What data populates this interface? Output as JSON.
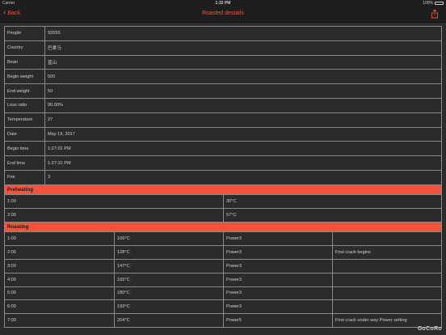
{
  "status": {
    "carrier": "Carrier",
    "time": "1:32 PM",
    "battery": "100%"
  },
  "nav": {
    "back_label": "Back",
    "title": "Roasted destails"
  },
  "details": [
    {
      "label": "People",
      "value": "55555"
    },
    {
      "label": "Country",
      "value": "巴拿马"
    },
    {
      "label": "Bean",
      "value": "蓝山"
    },
    {
      "label": "Begin weight",
      "value": "500"
    },
    {
      "label": "End weight",
      "value": "50"
    },
    {
      "label": "Loss ratio",
      "value": "90.00%"
    },
    {
      "label": "Temperature",
      "value": "27"
    },
    {
      "label": "Date",
      "value": "May 19, 2017"
    },
    {
      "label": "Begin time",
      "value": "1:27:01 PM"
    },
    {
      "label": "End time",
      "value": "1:27:31 PM"
    },
    {
      "label": "Fire",
      "value": "3"
    }
  ],
  "preheating": {
    "title": "Preheating",
    "rows": [
      {
        "time": "1:00",
        "temp": "30°C"
      },
      {
        "time": "2:00",
        "temp": "57°C"
      }
    ]
  },
  "roasting": {
    "title": "Roasting",
    "rows": [
      {
        "time": "1:00",
        "temp": "106°C",
        "power": "Power3",
        "note": ""
      },
      {
        "time": "2:00",
        "temp": "128°C",
        "power": "Power3",
        "note": "First crack begins"
      },
      {
        "time": "3:00",
        "temp": "147°C",
        "power": "Power3",
        "note": ""
      },
      {
        "time": "4:00",
        "temp": "165°C",
        "power": "Power3",
        "note": ""
      },
      {
        "time": "5:00",
        "temp": "180°C",
        "power": "Power3",
        "note": ""
      },
      {
        "time": "6:00",
        "temp": "193°C",
        "power": "Power3",
        "note": ""
      },
      {
        "time": "7:00",
        "temp": "204°C",
        "power": "Power5",
        "note": "First crack under way Power setting"
      }
    ]
  },
  "watermark": "GoCoRo",
  "colors": {
    "accent": "#f0553c",
    "background": "#2b2b2b",
    "bar": "#1e1e1e"
  }
}
